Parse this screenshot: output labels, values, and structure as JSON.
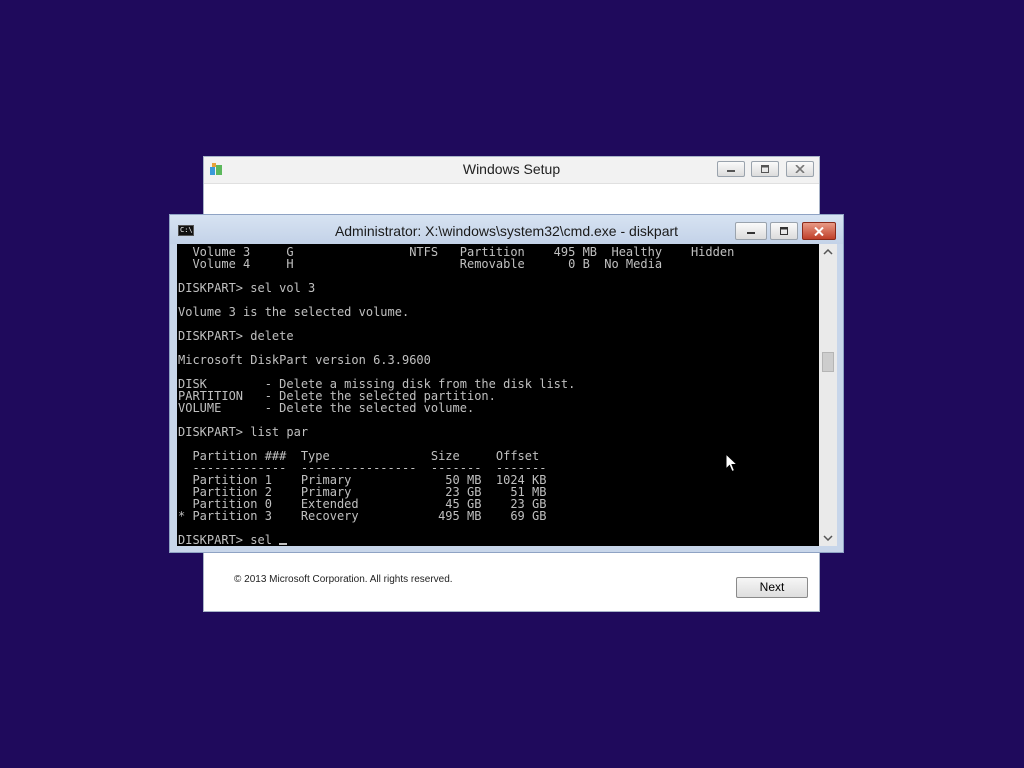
{
  "setup_window": {
    "title": "Windows Setup",
    "copyright": "© 2013 Microsoft Corporation. All rights reserved.",
    "next_label": "Next"
  },
  "cmd_window": {
    "title": "Administrator: X:\\windows\\system32\\cmd.exe - diskpart",
    "icon_text": "C:\\",
    "lines": [
      "  Volume 3     G                NTFS   Partition    495 MB  Healthy    Hidden",
      "  Volume 4     H                       Removable      0 B  No Media",
      "",
      "DISKPART> sel vol 3",
      "",
      "Volume 3 is the selected volume.",
      "",
      "DISKPART> delete",
      "",
      "Microsoft DiskPart version 6.3.9600",
      "",
      "DISK        - Delete a missing disk from the disk list.",
      "PARTITION   - Delete the selected partition.",
      "VOLUME      - Delete the selected volume.",
      "",
      "DISKPART> list par",
      "",
      "  Partition ###  Type              Size     Offset",
      "  -------------  ----------------  -------  -------",
      "  Partition 1    Primary             50 MB  1024 KB",
      "  Partition 2    Primary             23 GB    51 MB",
      "  Partition 0    Extended            45 GB    23 GB",
      "* Partition 3    Recovery           495 MB    69 GB",
      ""
    ],
    "prompt_line": "DISKPART> sel "
  },
  "colors": {
    "desktop": "#1f0a5c",
    "console_bg": "#000000",
    "console_fg": "#c0c0c0",
    "close_button": "#c0402a"
  }
}
